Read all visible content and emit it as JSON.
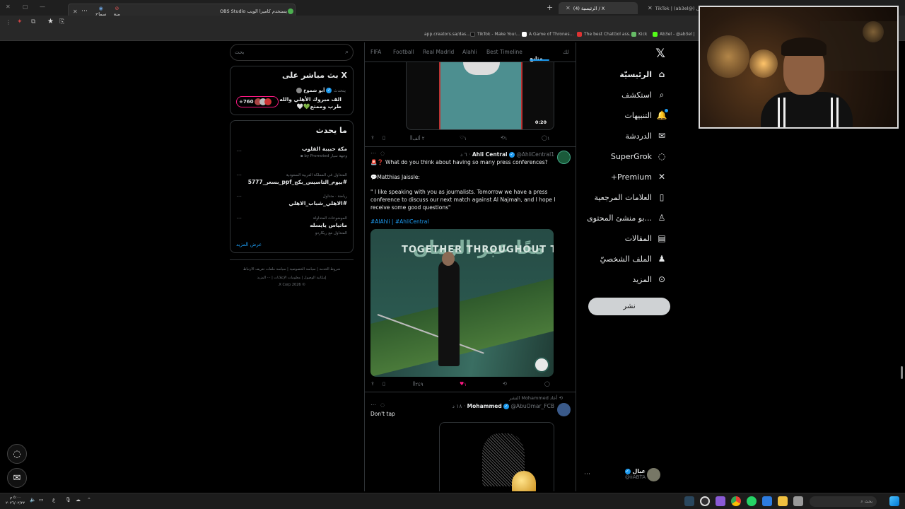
{
  "browser": {
    "tabs": [
      {
        "label": "TikTok | (ab3el@) عبال",
        "active": false
      },
      {
        "label": "(4) الرئيسية / X",
        "active": true
      }
    ],
    "notification": {
      "text": "OBS Studio يستخدم كاميرا الويب",
      "allow": "سماح",
      "block": "منع"
    },
    "bookmarks": [
      "app.creators.sa/das...",
      "TikTok - Make Your...",
      "A Game of Thrones...",
      "The best ChatGol ass...",
      "Kick",
      "Ab3el - @ab3el |"
    ]
  },
  "nav": {
    "items": [
      {
        "label": "الرئيسيّة",
        "icon": "home-icon",
        "glyph": "⌂",
        "bold": true
      },
      {
        "label": "استكشف",
        "icon": "search-icon",
        "glyph": "⌕"
      },
      {
        "label": "التنبيهات",
        "icon": "bell-icon",
        "glyph": "🔔"
      },
      {
        "label": "الدردشة",
        "icon": "mail-icon",
        "glyph": "✉"
      },
      {
        "label": "SuperGrok",
        "icon": "grok-icon",
        "glyph": "◌"
      },
      {
        "label": "Premium+",
        "icon": "x-icon",
        "glyph": "✕"
      },
      {
        "label": "العلامات المرجعية",
        "icon": "bookmark-icon",
        "glyph": "▯"
      },
      {
        "label": "...بو منشئ المحتوى",
        "icon": "creator-icon",
        "glyph": "♙"
      },
      {
        "label": "المقالات",
        "icon": "article-icon",
        "glyph": "▤"
      },
      {
        "label": "الملف الشخصيّ",
        "icon": "person-icon",
        "glyph": "♟"
      },
      {
        "label": "المزيد",
        "icon": "more-icon",
        "glyph": "⊙"
      }
    ],
    "post_button": "نشر",
    "profile": {
      "name": "عبال",
      "handle": "@iiABTA"
    }
  },
  "feed": {
    "tabs": [
      "FIFA",
      "Football",
      "Real Madrid",
      "Alahli",
      "Best Timeline",
      "متابع",
      "لك"
    ],
    "video1": {
      "duration": "0:20"
    },
    "video1_actions": {
      "views": "٢ ألف",
      "likes": "١",
      "reposts": "١",
      "replies": "١"
    },
    "tweet1": {
      "name": "Ahli Central",
      "handle": "@AhliCentral1",
      "time": "٦ د",
      "line1": "🚨❓ What do you think about having so many press conferences?",
      "line2": "💬Matthias Jaissle:",
      "quote": "\" I like speaking with you as journalists. Tomorrow we have a press conference to discuss our next match against Al Najmah, and I hope I receive some good questions\"",
      "hashtags": "#AlAhli | #AhliCentral",
      "photo_text": "TOGETHER THROUGHOUT TIME",
      "photo_arabic": "معًا عبر الزمان",
      "views": "٢٤٩",
      "likes": "١",
      "reposts": "",
      "replies": ""
    },
    "tweet2": {
      "repost_note": "أعاد Mohammed النشر",
      "name": "Mohammed",
      "handle": "@AbuOmar_FCB",
      "time": "١٨ د",
      "text": "Don't tap"
    }
  },
  "sidebar": {
    "search_placeholder": "بحث",
    "live": {
      "title": "X بث مباشر على",
      "user": "أبو شموع",
      "status": "يتحدث",
      "text": "الف مبروك الأهلي والله طرب وممتع💚🤍",
      "count": "+760"
    },
    "trending": {
      "title": "ما يحدث",
      "items": [
        {
          "meta": "",
          "title": "مكة حبيبة القلوب",
          "extra": "وجهة سيار by Promoted"
        },
        {
          "meta": "المتداول في المملكة العربية السعودية",
          "title": "#بيوم_التاسيس_بكج_ppf_بسعر_5777",
          "extra": ""
        },
        {
          "meta": "رياضة · متداول",
          "title": "#الاهلي_شباب_الاهلي",
          "extra": ""
        },
        {
          "meta": "الموضوعات المتداولة",
          "title": "ماتياس يايسله",
          "extra": "المتداول مع ريكاردو"
        }
      ],
      "show_more": "عرض المزيد"
    },
    "footer": {
      "line1": "شروط الخدمة | سياسة الخصوصية | سياسة ملفات تعريف الارتباط",
      "line2": "إمكانية الوصول | معلومات الإعلانات | ··· المزيد",
      "line3": "© 2026 X Corp."
    }
  },
  "taskbar": {
    "search": "بحث",
    "clock_time": "٥:٠٠ م",
    "clock_date": "٢٠٢٦/٠٢/٢٢"
  }
}
